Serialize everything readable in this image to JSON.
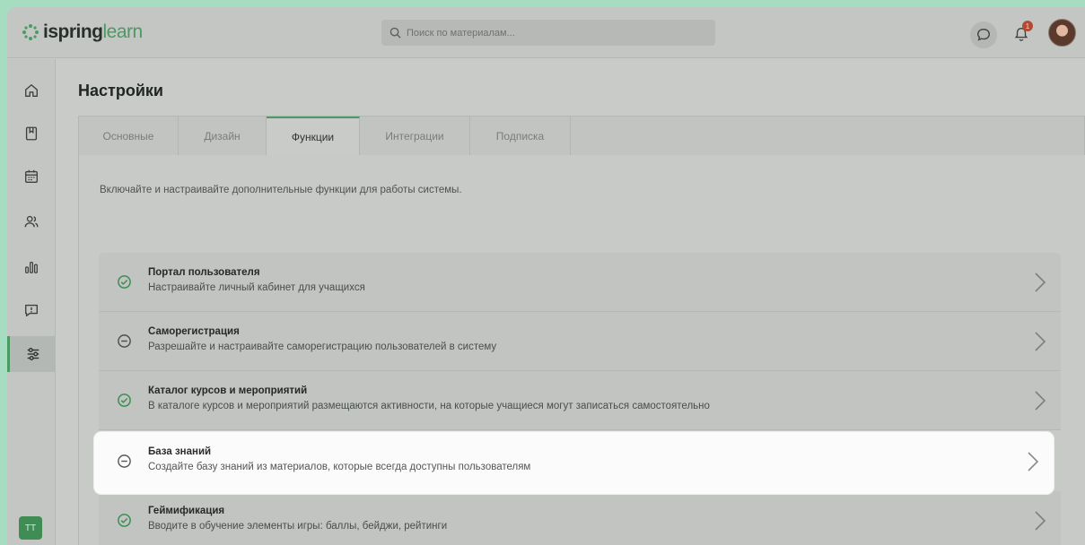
{
  "header": {
    "logo_prefix": "ispring",
    "logo_suffix": "learn",
    "search_placeholder": "Поиск по материалам...",
    "notifications_count": "1"
  },
  "sidebar": {
    "items": [
      {
        "icon": "home-icon"
      },
      {
        "icon": "book-icon"
      },
      {
        "icon": "calendar-icon"
      },
      {
        "icon": "users-icon"
      },
      {
        "icon": "analytics-icon"
      },
      {
        "icon": "feedback-icon"
      },
      {
        "icon": "settings-sliders-icon",
        "active": true
      }
    ],
    "user_initials": "TT"
  },
  "page": {
    "title": "Настройки",
    "tabs": [
      {
        "label": "Основные"
      },
      {
        "label": "Дизайн"
      },
      {
        "label": "Функции",
        "active": true
      },
      {
        "label": "Интеграции"
      },
      {
        "label": "Подписка"
      }
    ],
    "description": "Включайте и настраивайте дополнительные функции для работы системы."
  },
  "features": [
    {
      "title": "Портал пользователя",
      "subtitle": "Настраивайте личный кабинет для учащихся",
      "status": "enabled"
    },
    {
      "title": "Саморегистрация",
      "subtitle": "Разрешайте и настраивайте саморегистрацию пользователей в систему",
      "status": "disabled"
    },
    {
      "title": "Каталог курсов и мероприятий",
      "subtitle": "В каталоге курсов и мероприятий размещаются активности, на которые учащиеся могут записаться самостоятельно",
      "status": "enabled"
    },
    {
      "title": "База знаний",
      "subtitle": "Создайте базу знаний из материалов, которые всегда доступны пользователям",
      "status": "disabled",
      "highlighted": true
    },
    {
      "title": "Геймификация",
      "subtitle": "Вводите в обучение элементы игры: баллы, бейджи, рейтинги",
      "status": "enabled"
    }
  ],
  "colors": {
    "accent": "#4a9a62",
    "background": "#a6dcc0"
  }
}
